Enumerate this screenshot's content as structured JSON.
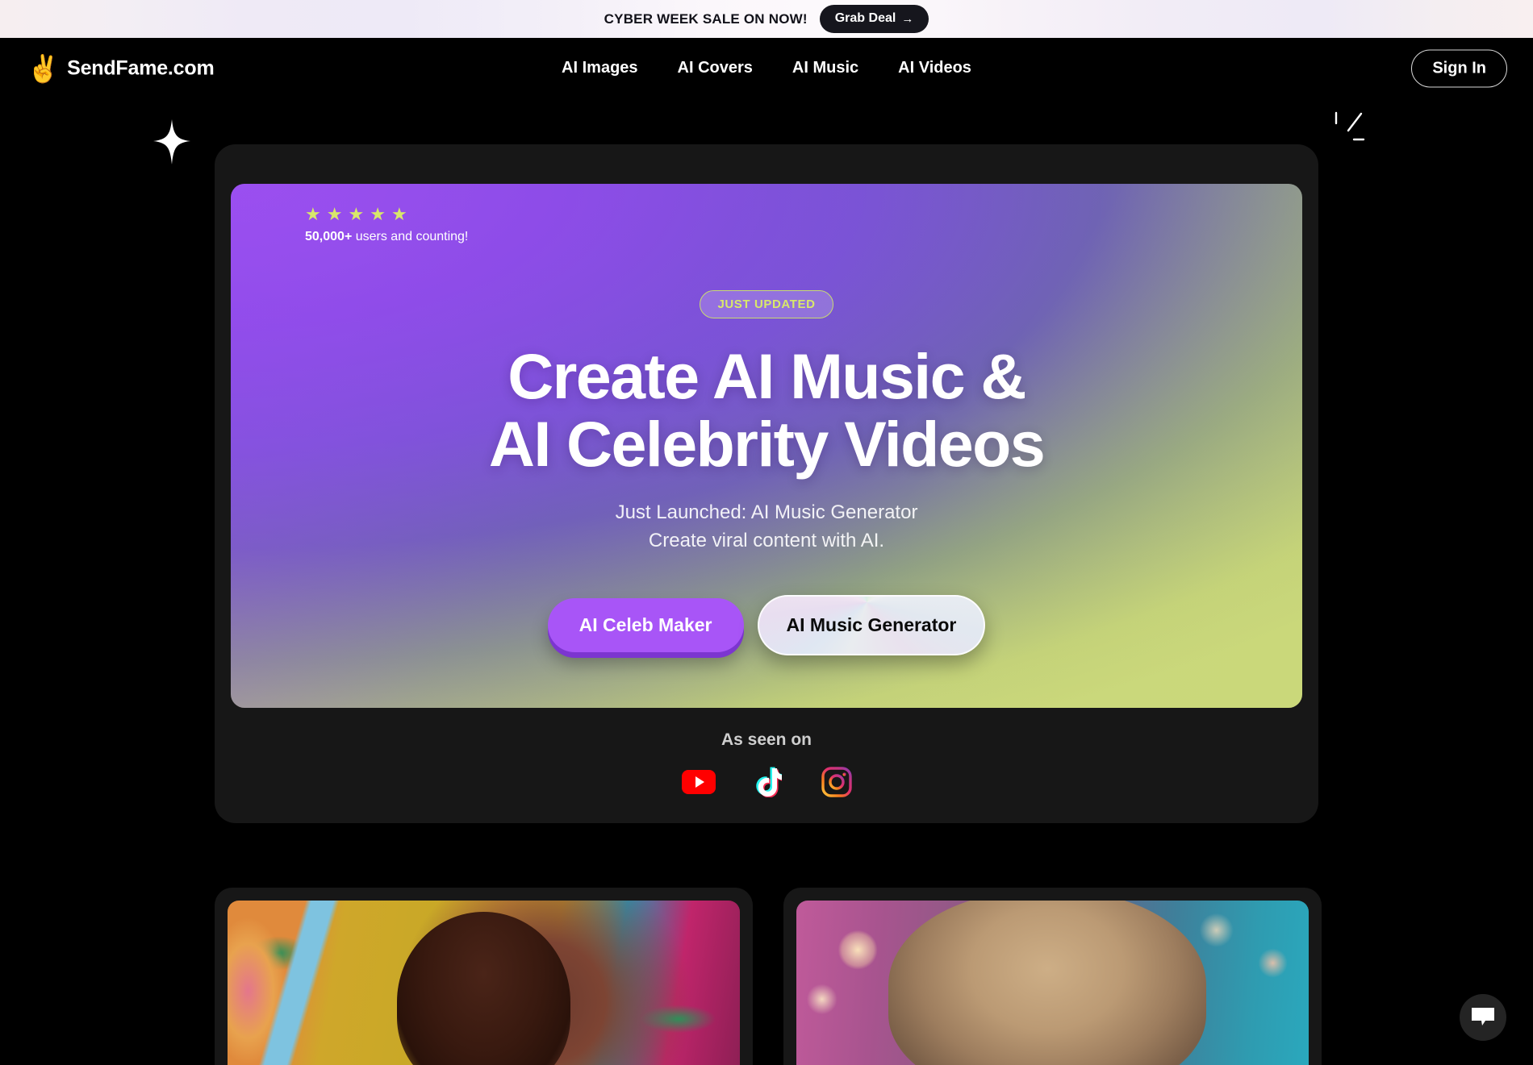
{
  "promo": {
    "text": "CYBER WEEK SALE ON NOW!",
    "button_label": "Grab Deal",
    "button_arrow": "→",
    "icon": "arrow-right-icon"
  },
  "nav": {
    "brand": {
      "emoji": "✌️",
      "icon": "peace-hand-icon",
      "name": "SendFame.com"
    },
    "links": [
      {
        "label": "AI Images"
      },
      {
        "label": "AI Covers"
      },
      {
        "label": "AI Music"
      },
      {
        "label": "AI Videos"
      }
    ],
    "signin_label": "Sign In"
  },
  "decorations": {
    "sparkle_left": "sparkle-icon",
    "sparkle_right": "sparkle-lines-icon"
  },
  "hero": {
    "rating": {
      "star_count": 5,
      "star_glyph": "★",
      "count_bold": "50,000+",
      "count_rest": " users and counting!"
    },
    "badge": "JUST UPDATED",
    "title_line1": "Create AI Music &",
    "title_line2": "AI Celebrity Videos",
    "subtitle_line1": "Just Launched: AI Music Generator",
    "subtitle_line2": "Create viral content with AI.",
    "cta_primary": "AI Celeb Maker",
    "cta_secondary": "AI Music Generator",
    "colors": {
      "gradient_start": "#9b4ff0",
      "gradient_mid": "#6f63b4",
      "gradient_end": "#cbd87c",
      "accent_purple": "#a855f7",
      "accent_lime": "#d8e86a",
      "card_bg": "#171717",
      "page_bg": "#000000"
    }
  },
  "as_seen_on": {
    "label": "As seen on",
    "platforms": [
      {
        "name": "YouTube",
        "icon": "youtube-icon",
        "color": "#ff0000"
      },
      {
        "name": "TikTok",
        "icon": "tiktok-icon",
        "color": "#ffffff"
      },
      {
        "name": "Instagram",
        "icon": "instagram-icon",
        "color": "#e1306c"
      }
    ]
  },
  "gallery": {
    "cards": [
      {
        "name": "ai-portrait-card-1",
        "alt": "Woman with braided hair on colorful tropical collage background"
      },
      {
        "name": "ai-portrait-card-2",
        "alt": "Woman with blonde hair and bokeh light background"
      }
    ]
  },
  "chat": {
    "icon": "chat-bubble-icon",
    "label": "Open chat"
  }
}
